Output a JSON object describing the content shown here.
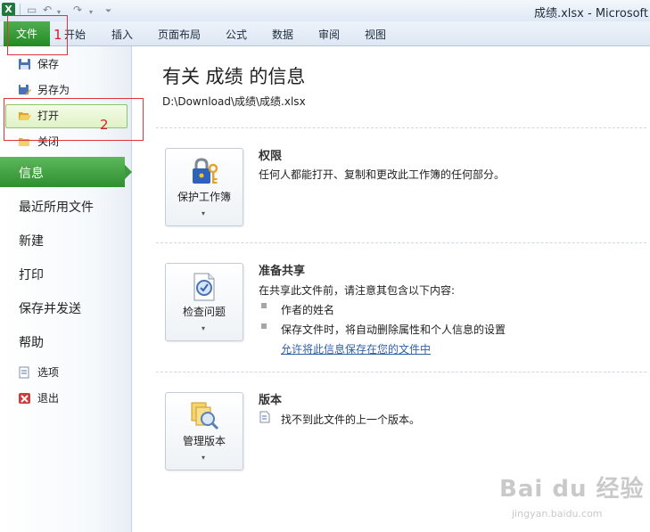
{
  "window": {
    "title": "成绩.xlsx  -  Microsoft"
  },
  "ribbon": {
    "file_tab": "文件",
    "tabs": [
      "开始",
      "插入",
      "页面布局",
      "公式",
      "数据",
      "审阅",
      "视图"
    ]
  },
  "backstage": {
    "commands": [
      "保存",
      "另存为",
      "打开",
      "关闭"
    ],
    "nav": [
      "信息",
      "最近所用文件",
      "新建",
      "打印",
      "保存并发送",
      "帮助"
    ],
    "footer": [
      "选项",
      "退出"
    ]
  },
  "annotations": [
    "1",
    "2"
  ],
  "info": {
    "title": "有关 成绩 的信息",
    "path": "D:\\Download\\成绩\\成绩.xlsx",
    "sections": [
      {
        "button": "保护工作簿",
        "heading": "权限",
        "text": "任何人都能打开、复制和更改此工作簿的任何部分。"
      },
      {
        "button": "检查问题",
        "heading": "准备共享",
        "text": "在共享此文件前，请注意其包含以下内容:",
        "bullets": [
          "作者的姓名",
          "保存文件时，将自动删除属性和个人信息的设置"
        ],
        "link": "允许将此信息保存在您的文件中"
      },
      {
        "button": "管理版本",
        "heading": "版本",
        "text": "找不到此文件的上一个版本。"
      }
    ]
  },
  "watermark": {
    "brand": "Bai du 经验",
    "url": "jingyan.baidu.com"
  },
  "colors": {
    "file_tab": "#2e8e2e",
    "nav_active": "#3d9a3d",
    "annotation": "#e0333a",
    "link": "#2f5fa6"
  }
}
